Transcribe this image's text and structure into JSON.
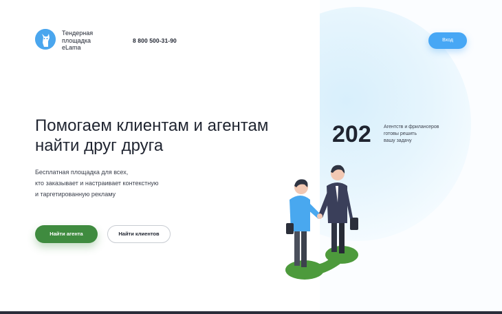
{
  "header": {
    "brand_lines": [
      "Тендерная",
      "площадка",
      "eLama"
    ],
    "phone": "8 800 500-31-90",
    "login_label": "Вход"
  },
  "hero": {
    "title_lines": [
      "Помогаем клиентам и агентам",
      "найти друг друга"
    ],
    "subtitle_lines": [
      "Бесплатная площадка для всех,",
      "кто заказывает и настраивает контекстную",
      "и таргетированную рекламу"
    ],
    "primary_button": "Найти агента",
    "secondary_button": "Найти клиентов"
  },
  "stat": {
    "value": "202",
    "desc_lines": [
      "Агентств и фрилансеров",
      "готовы решить",
      "вашу задачу"
    ]
  },
  "icons": {
    "logo": "llama-logo-icon",
    "illustration": "handshake-illustration"
  },
  "colors": {
    "accent_blue": "#47a7f5",
    "accent_green": "#3f8b3f",
    "text_dark": "#1f2430"
  }
}
